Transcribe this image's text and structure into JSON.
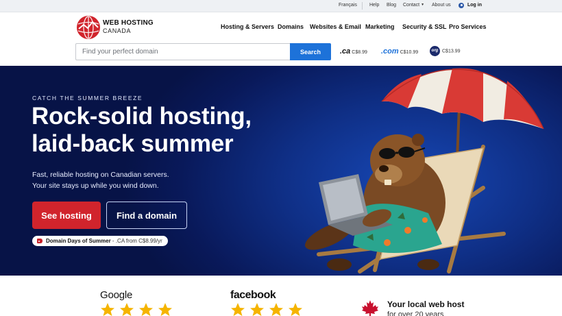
{
  "utility_bar": {
    "language": "Français",
    "help": "Help",
    "blog": "Blog",
    "contact": "Contact",
    "about": "About us",
    "login": "Log in"
  },
  "brand": {
    "line1": "WEB HOSTING",
    "line2": "CANADA",
    "color": "#d1242c"
  },
  "nav": {
    "items": [
      "Hosting & Servers",
      "Domains",
      "Websites & Email",
      "Marketing",
      "Security & SSL",
      "Pro Services"
    ]
  },
  "domain_search": {
    "placeholder": "Find your perfect domain",
    "value": "",
    "button": "Search",
    "button_color": "#1d72d9"
  },
  "tld_prices": [
    {
      "name": ".ca",
      "price": "C$8.99"
    },
    {
      "name": ".com",
      "price": "C$10.99"
    },
    {
      "name": "org",
      "price": "C$13.99"
    }
  ],
  "hero": {
    "eyebrow": "CATCH THE SUMMER BREEZE",
    "headline_line1": "Rock-solid hosting,",
    "headline_line2": "laid-back summer",
    "sub_line1": "Fast, reliable hosting on Canadian servers.",
    "sub_line2": "Your site stays up while you wind down.",
    "primary_button": "See hosting",
    "secondary_button": "Find a domain",
    "promo_bold": "Domain Days of Summer",
    "promo_detail": " - .CA from C$8.99/yr",
    "illustration": "beaver-in-beach-chair-with-laptop-under-umbrella"
  },
  "reviews": {
    "google": "Google",
    "facebook": "facebook",
    "star_color": "#f5b400"
  },
  "trust": {
    "title": "Your local web host",
    "subtitle": "for over 20 years",
    "icon": "maple-leaf-icon"
  }
}
